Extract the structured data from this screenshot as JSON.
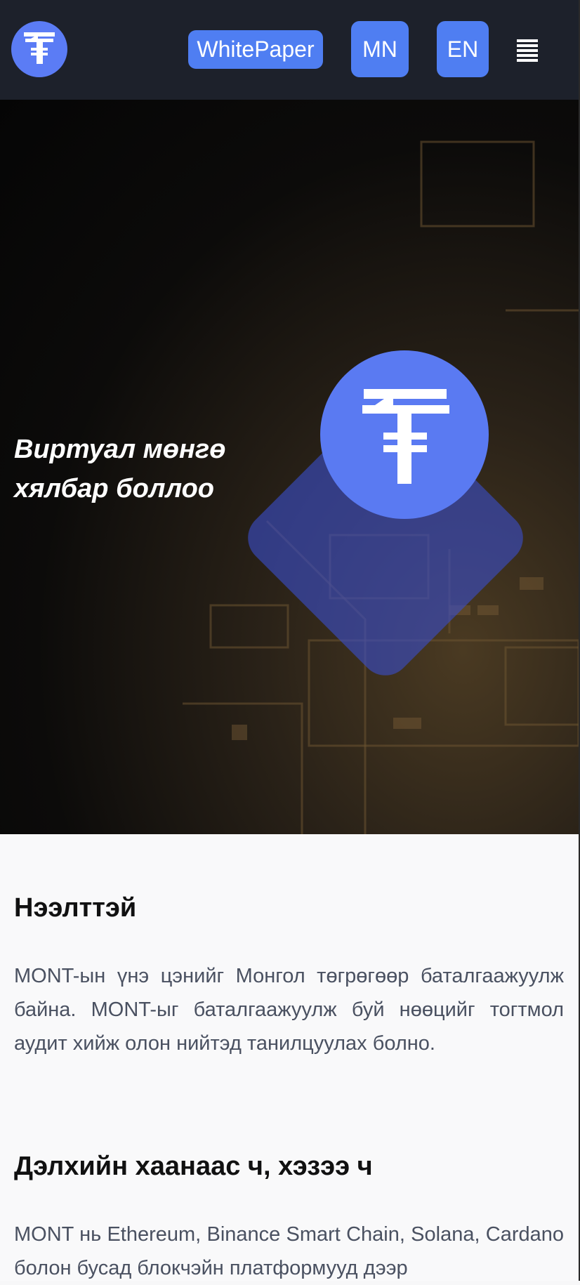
{
  "header": {
    "logo_icon": "tugrik-coin-icon",
    "whitepaper_label": "WhitePaper",
    "lang_mn_label": "MN",
    "lang_en_label": "EN",
    "menu_icon": "hamburger-menu-icon"
  },
  "hero": {
    "title": "Виртуал мөнгө хялбар боллоо",
    "coin_icon": "tugrik-coin-icon"
  },
  "sections": [
    {
      "title": "Нээлттэй",
      "text": "MONT-ын үнэ цэнийг Монгол төгрөгөөр баталгаажуулж байна. MONT-ыг баталгаажуулж буй нөөцийг тогтмол аудит хийж олон нийтэд танилцуулах болно."
    },
    {
      "title": "Дэлхийн хаанаас ч, хэзээ ч",
      "text": "MONT нь Ethereum, Binance Smart Chain, Solana, Cardano болон бусад блокчэйн платформууд дээр"
    }
  ],
  "colors": {
    "header_bg": "#1d212b",
    "accent": "#4f7ef2",
    "coin": "#5a7af2",
    "diamond": "#3a4ec8"
  }
}
